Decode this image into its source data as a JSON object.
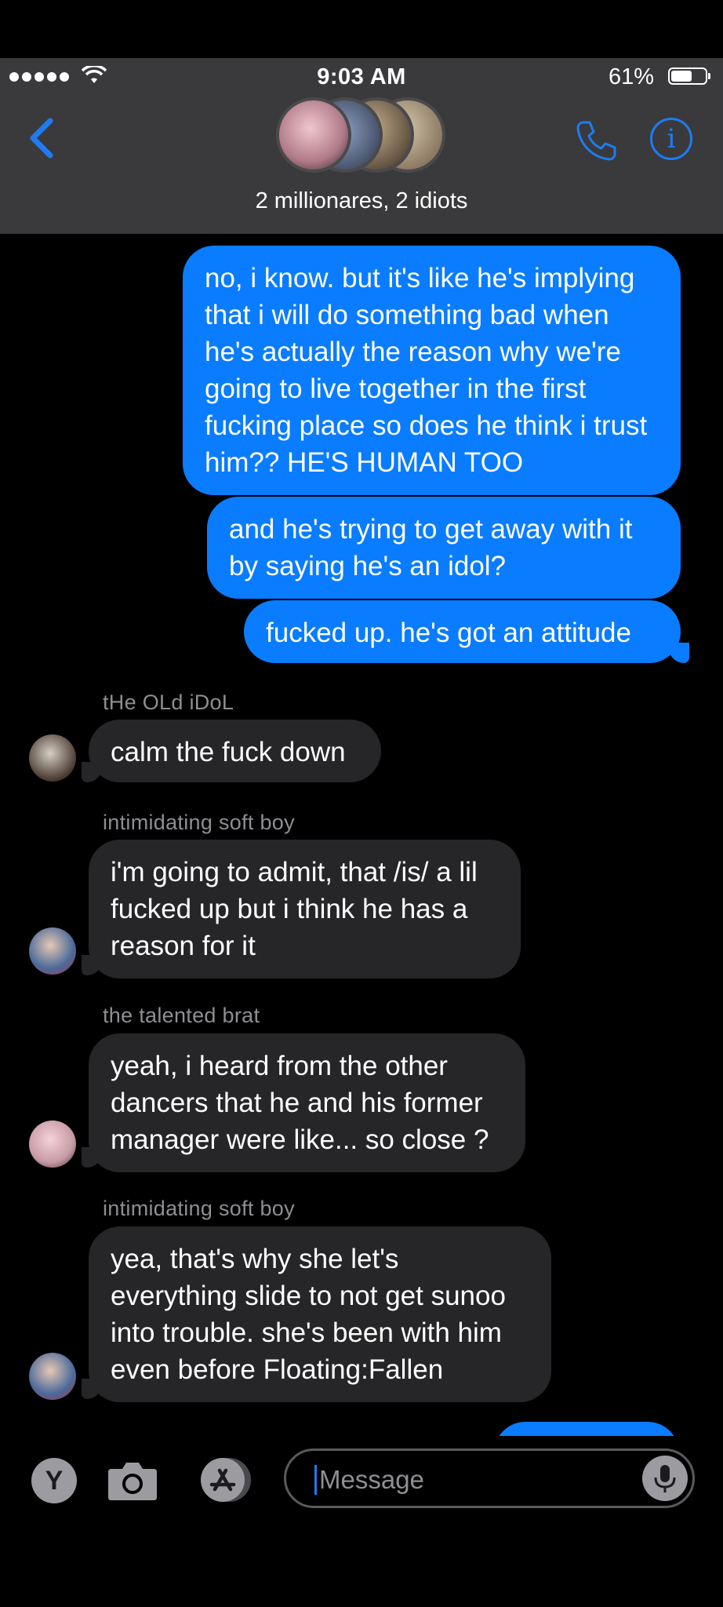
{
  "status_bar": {
    "time": "9:03 AM",
    "battery": "61%",
    "battery_level": 0.61
  },
  "conversation": {
    "title": "2 millionares, 2 idiots"
  },
  "messages": [
    {
      "from": "me",
      "text": "no, i know. but it's like he's implying that i will do something bad when he's actually the reason why we're going to live together in the first fucking place so does he think i trust him?? HE'S HUMAN TOO"
    },
    {
      "from": "me",
      "text": "and he's trying to get away with it by saying he's an idol?"
    },
    {
      "from": "me",
      "text": "fucked up. he's got an attitude"
    },
    {
      "from": "them",
      "sender": "tHe OLd iDoL",
      "text": "calm the fuck down"
    },
    {
      "from": "them",
      "sender": "intimidating soft boy",
      "text": "i'm going to admit, that /is/ a lil fucked up but i think he has a reason for it"
    },
    {
      "from": "them",
      "sender": "the talented brat",
      "text": "yeah, i heard from the other dancers that he and his former manager were like... so close ?"
    },
    {
      "from": "them",
      "sender": "intimidating soft boy",
      "text": "yea, that's why she let's everything slide to not get sunoo into trouble. she's been with him even before Floating:Fallen"
    }
  ],
  "composer": {
    "placeholder": "Message",
    "apps_button_label": "Y"
  },
  "colors": {
    "accent": "#1e7cf2",
    "outgoing_bubble": "#0a7cff",
    "incoming_bubble": "#262628"
  },
  "icons": [
    "back-chevron-icon",
    "phone-icon",
    "info-icon",
    "camera-icon",
    "app-store-icon",
    "microphone-icon",
    "wifi-icon"
  ]
}
